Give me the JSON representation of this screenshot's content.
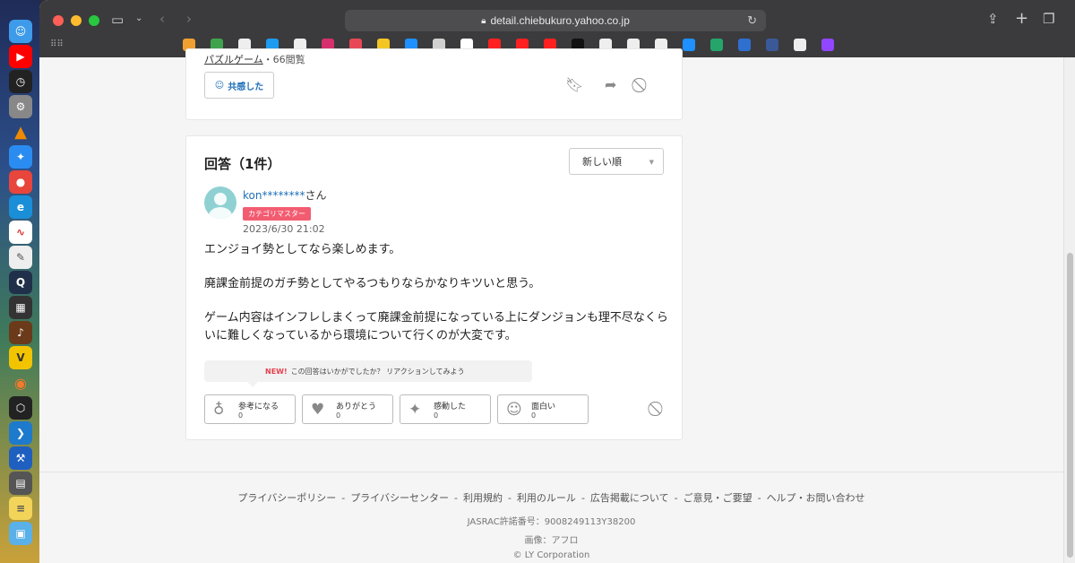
{
  "browser": {
    "url": "detail.chiebukuro.yahoo.co.jp",
    "traffic_colors": [
      "#fe5f57",
      "#febc2e",
      "#28c840"
    ],
    "bookmark_colors": [
      "#f0a030",
      "#3fa34d",
      "#eeeeee",
      "#1d9bf0",
      "#eeeeee",
      "#d6306e",
      "#e84855",
      "#f3c623",
      "#1e90ff",
      "#d0d0d0",
      "#ffffff",
      "#ff2020",
      "#ff2020",
      "#ff2020",
      "#111111",
      "#eeeeee",
      "#eeeeee",
      "#eeeeee",
      "#1e90ff",
      "#25a56a",
      "#2f6fd0",
      "#3b5998",
      "#eeeeee",
      "#9146ff"
    ]
  },
  "question_card": {
    "tag": "パズルゲーム",
    "views": "・66閲覧",
    "sympathy_label": "共感した"
  },
  "answers": {
    "title": "回答（1件）",
    "sort_selected": "新しい順",
    "user_name": "kon********",
    "user_suffix": "さん",
    "badge": "カテゴリマスター",
    "date": "2023/6/30 21:02",
    "body": [
      "エンジョイ勢としてなら楽しめます。",
      "廃課金前提のガチ勢としてやるつもりならかなりキツいと思う。",
      "ゲーム内容はインフレしまくって廃課金前提になっている上にダンジョンも理不尽なくらいに難しくなっているから環境について行くのが大変です。"
    ],
    "prompt_new": "NEW!",
    "prompt_text": "この回答はいかがでしたか？ リアクションしてみよう",
    "reactions": [
      {
        "label": "参考になる",
        "count": "0",
        "icon": "lightbulb-icon"
      },
      {
        "label": "ありがとう",
        "count": "0",
        "icon": "heart-icon"
      },
      {
        "label": "感動した",
        "count": "0",
        "icon": "sparkle-icon"
      },
      {
        "label": "面白い",
        "count": "0",
        "icon": "smile-icon"
      }
    ]
  },
  "footer": {
    "links": [
      "プライバシーポリシー",
      "プライバシーセンター",
      "利用規約",
      "利用のルール",
      "広告掲載について",
      "ご意見・ご要望",
      "ヘルプ・お問い合わせ"
    ],
    "separator": "-",
    "jasrac": "JASRAC許諾番号：9008249113Y38200",
    "image_credit": "画像：アフロ",
    "copyright": "© LY Corporation"
  }
}
